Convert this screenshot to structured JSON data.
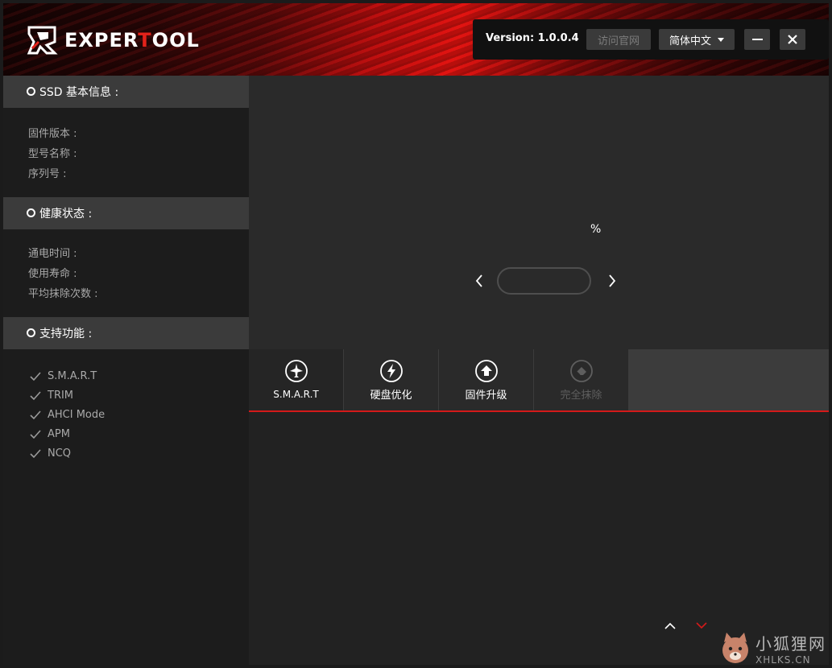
{
  "header": {
    "logo_text_a": "EXPER",
    "logo_text_b": "T",
    "logo_text_c": "OOL",
    "version": "Version: 1.0.0.4",
    "visit_site": "访问官网",
    "language": "简体中文",
    "brand_color": "#e3221a"
  },
  "sidebar": {
    "ssd_info": {
      "title": "SSD 基本信息 :",
      "rows": [
        "固件版本 :",
        "型号名称 :",
        "序列号 :"
      ]
    },
    "health": {
      "title": "健康状态 :",
      "rows": [
        "通电时间 :",
        "使用寿命 :",
        "平均抹除次数 :"
      ]
    },
    "features": {
      "title": "支持功能 :",
      "items": [
        "S.M.A.R.T",
        "TRIM",
        "AHCI Mode",
        "APM",
        "NCQ"
      ]
    }
  },
  "main": {
    "percent_sign": "%",
    "selector_value": ""
  },
  "tabs": [
    {
      "label": "S.M.A.R.T",
      "icon": "airplane-icon",
      "state": "active"
    },
    {
      "label": "硬盘优化",
      "icon": "lightning-icon",
      "state": "normal"
    },
    {
      "label": "固件升级",
      "icon": "upload-arrow-icon",
      "state": "normal"
    },
    {
      "label": "完全抹除",
      "icon": "eraser-icon",
      "state": "disabled"
    }
  ],
  "accent_line_color": "#d41a1a",
  "watermark": {
    "cn": "小狐狸网",
    "en": "XHLKS.CN"
  }
}
